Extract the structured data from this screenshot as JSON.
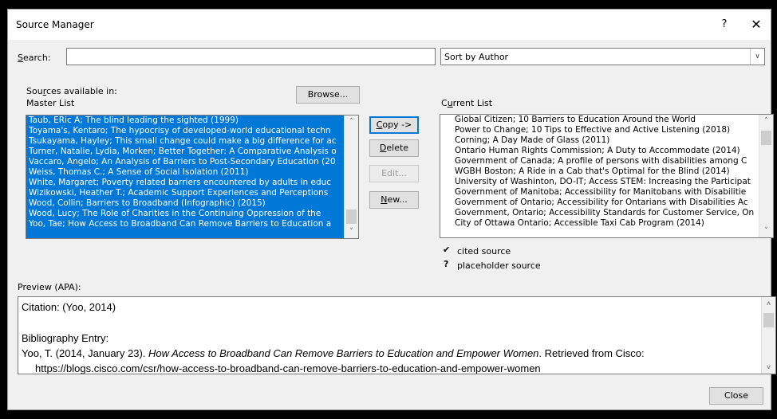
{
  "window": {
    "title": "Source Manager",
    "help_glyph": "?",
    "close_glyph": "✕"
  },
  "search": {
    "label_u": "S",
    "label_rest": "earch:",
    "value": "",
    "placeholder": ""
  },
  "sort": {
    "selected": "Sort by Author",
    "arrow": "∨"
  },
  "master": {
    "available_label_pre": "Sou",
    "available_label_u": "r",
    "available_label_post": "ces available in:",
    "list_label": "Master List",
    "browse_label": "Browse...",
    "items": [
      "Taub, ERic A; The blind leading the sighted (1999)",
      "Toyama's, Kentaro; The hypocrisy of developed-world educational techn",
      "Tsukayama, Hayley; This small change could make a big difference for ac",
      "Turner, Natalie, Lydia, Morken; Better Together: A Comparative Analysis o",
      "Vaccaro, Angelo; An Analysis of Barriers to Post-Secondary Education (20",
      "Weiss, Thomas C.; A Sense of Social Isolation (2011)",
      "White, Margaret; Poverty related barriers encountered by adults in educ",
      "Wizikowski, Heather T.; Academic Support Experiences and Perceptions",
      "Wood, Collin; Barriers to Broadband (Infographic) (2015)",
      "Wood, Lucy; The Role of Charities in the Continuing Oppression of the",
      "Yoo, Tae; How Access to Broadband Can Remove Barriers to Education a"
    ]
  },
  "actions": {
    "copy_u": "C",
    "copy_rest": "opy ->",
    "delete_u": "D",
    "delete_rest": "elete",
    "edit": "Edit...",
    "new_u": "N",
    "new_rest": "ew..."
  },
  "current": {
    "label_pre": "C",
    "label_u": "u",
    "label_post": "rrent List",
    "items": [
      "Global Citizen; 10 Barriers to Education Around the World",
      "Power to Change; 10 Tips to Effective and Active Listening (2018)",
      "Corning; A Day Made of Glass (2011)",
      "Ontario Human Rights Commission; A Duty to Accommodate (2014)",
      "Government of Canada; A profile of persons with disabilities among C",
      "WGBH Boston; A Ride in a Cab that's Optimal for the Blind (2014)",
      "University of Washinton, DO-IT; Access STEM: Increasing the Participat",
      "Government of Manitoba; Accessibility for Manitobans with Disabilitie",
      "Government of Ontario; Accessibility for Ontarians with Disabilities Ac",
      "Government, Ontario; Accessibility Standards for Customer Service, On",
      "City of Ottawa Ontario; Accessible Taxi Cab Program (2014)"
    ]
  },
  "legend": {
    "cited_mark": "✔",
    "cited_label": "cited source",
    "placeholder_mark": "?",
    "placeholder_label": "placeholder source"
  },
  "preview": {
    "label": "Preview (APA):",
    "citation": "Citation:  (Yoo, 2014)",
    "bib_heading": "Bibliography Entry:",
    "bib_author": "Yoo, T. (2014, January 23). ",
    "bib_title": "How Access to Broadband Can Remove Barriers to Education and Empower Women",
    "bib_tail": ". Retrieved from Cisco:",
    "bib_url": "https://blogs.cisco.com/csr/how-access-to-broadband-can-remove-barriers-to-education-and-empower-women"
  },
  "footer": {
    "close_label": "Close"
  },
  "scroll_glyphs": {
    "up": "˄",
    "down": "˅"
  }
}
